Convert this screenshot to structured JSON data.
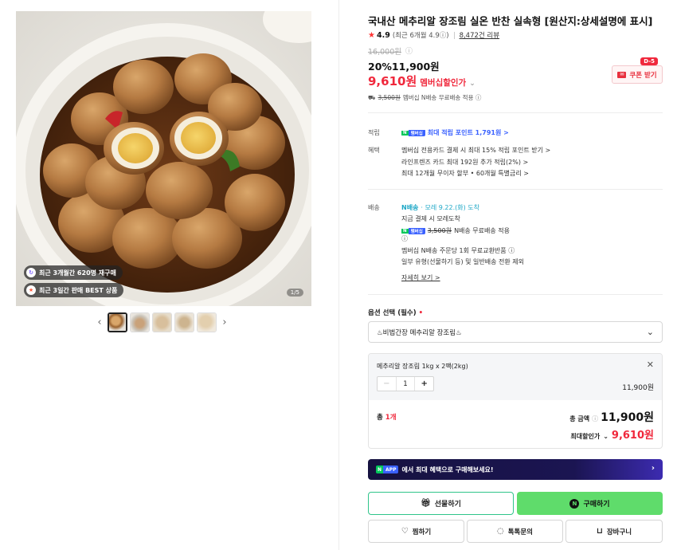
{
  "gallery": {
    "badges": [
      {
        "icon": "repurchase-icon",
        "text": "최근 3개월간 620명 재구매"
      },
      {
        "icon": "best-icon",
        "text": "최근 3일간 판매 BEST 상품"
      }
    ],
    "counter": "1/5",
    "prev_label": "‹",
    "next_label": "›"
  },
  "product": {
    "title": "국내산 메추리알 장조림 실온 반찬 실속형 [원산지:상세설명에 표시]",
    "rating": "4.9",
    "rating_detail": "(최근 6개월 4.9ⓘ)",
    "review_count": "8,472건 리뷰",
    "original_price": "16,000원",
    "sale": "20%11,900원",
    "member_price": "9,610원",
    "member_label": "멤버십할인가",
    "shipping_fee": "3,500원",
    "shipping_text": "멤버십 N배송 무료배송 적용 ⓘ",
    "coupon_label": "쿠폰 받기",
    "coupon_dday": "D-5"
  },
  "benefits": {
    "point_label": "적립",
    "point_chip_g": "N",
    "point_chip_b": "멤버십",
    "point_text": "최대 적립 포인트 1,791원 >",
    "benefit_label": "혜택",
    "benefit_lines": [
      "멤버십 전용카드 결제 시 최대 15% 적립 포인트 받기 >",
      "라인프렌즈 카드 최대 192원 추가 적립(2%) >",
      "최대 12개월 무이자 할부 • 60개월 특별금리 >"
    ]
  },
  "delivery": {
    "label": "배송",
    "badge": "N배송",
    "arrival": "· 모레 9.22.(화) 도착",
    "line2": "지금 결제 시 모레도착",
    "fee": "3,500원",
    "fee_text": "N배송 무료배송 적용",
    "info": "ⓘ",
    "line4": "멤버십 N배송 주문당 1회 무료교환반품 ⓘ",
    "line5": "일부 유형(선물하기 등) 및 일반배송 전환 제외",
    "more": "자세히 보기 >"
  },
  "options": {
    "label": "옵션 선택 (필수)",
    "required_mark": "•",
    "selected_value": "♨비법간장 메추리알 장조림♨",
    "item_name": "메추리알 장조림 1kg x 2팩(2kg)",
    "quantity": "1",
    "item_price": "11,900원",
    "total_count_label": "총",
    "total_count_value": "1개",
    "total_label": "총 금액",
    "total_info": "ⓘ",
    "total_amount": "11,900원",
    "max_label": "최대할인가",
    "max_amount": "9,610원"
  },
  "banner": {
    "chip_g": "N",
    "chip_b": "APP",
    "text": "에서 최대 혜택으로 구매해보세요!"
  },
  "buttons": {
    "gift": "선물하기",
    "buy": "구매하기",
    "wish": "찜하기",
    "talk": "톡톡문의",
    "cart": "장바구니"
  },
  "colors": {
    "accent_red": "#f0283c",
    "npay_green": "#03c75a",
    "buy_green": "#5fdc6b",
    "member_blue": "#3a61ff"
  }
}
